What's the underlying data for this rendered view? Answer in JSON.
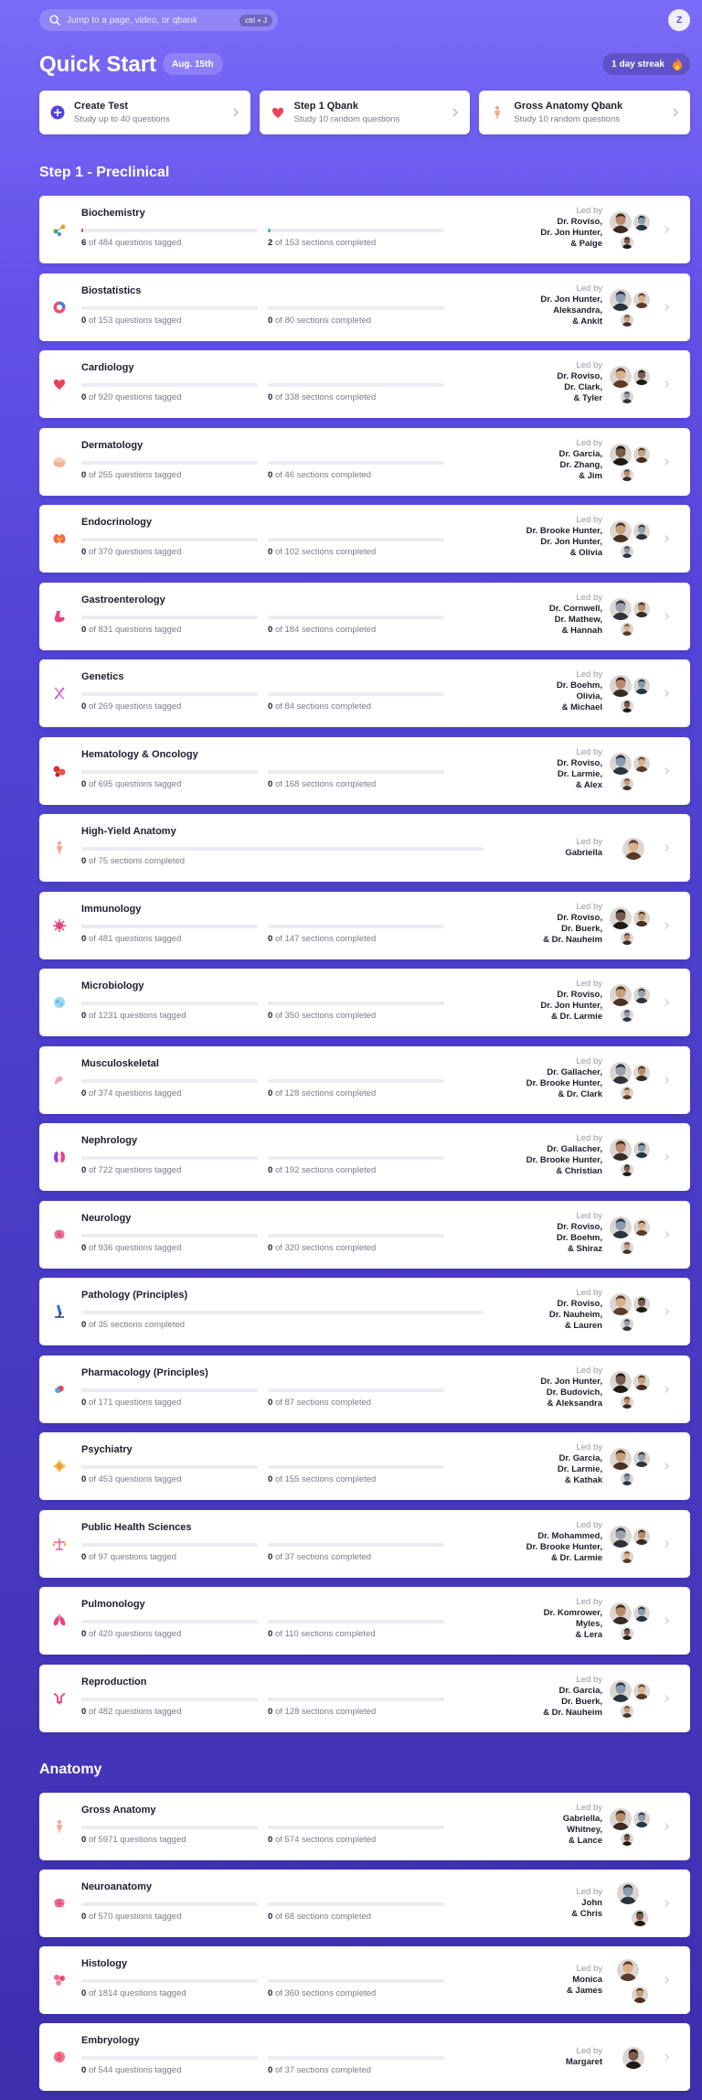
{
  "search": {
    "placeholder": "Jump to a page, video, or qbank",
    "shortcut": "ctrl + J"
  },
  "user": {
    "initial": "Z"
  },
  "header": {
    "title": "Quick Start",
    "date": "Aug. 15th",
    "streak": "1 day streak"
  },
  "quick": [
    {
      "title": "Create Test",
      "sub": "Study up to 40 questions"
    },
    {
      "title": "Step 1 Qbank",
      "sub": "Study 10 random questions"
    },
    {
      "title": "Gross Anatomy Qbank",
      "sub": "Study 10 random questions"
    }
  ],
  "sections": {
    "preclinical": "Step 1 - Preclinical",
    "anatomy": "Anatomy"
  },
  "labels": {
    "led_by": "Led by"
  },
  "preclinical": [
    {
      "name": "Biochemistry",
      "q_done": "6",
      "q_text": "of 484 questions tagged",
      "q_pct": 1.2,
      "s_done": "2",
      "s_text": "of 153 sections completed",
      "s_pct": 1.3,
      "leaders": [
        "Dr. Roviso,",
        "Dr. Jon Hunter,",
        "& Paige"
      ],
      "icon": "dna-molecule-icon"
    },
    {
      "name": "Biostatistics",
      "q_done": "0",
      "q_text": "of 153 questions tagged",
      "q_pct": 0,
      "s_done": "0",
      "s_text": "of 80 sections completed",
      "s_pct": 0,
      "leaders": [
        "Dr. Jon Hunter,",
        "Aleksandra,",
        "& Ankit"
      ],
      "icon": "pie-chart-icon"
    },
    {
      "name": "Cardiology",
      "q_done": "0",
      "q_text": "of 920 questions tagged",
      "q_pct": 0,
      "s_done": "0",
      "s_text": "of 338 sections completed",
      "s_pct": 0,
      "leaders": [
        "Dr. Roviso,",
        "Dr. Clark,",
        "& Tyler"
      ],
      "icon": "heart-icon"
    },
    {
      "name": "Dermatology",
      "q_done": "0",
      "q_text": "of 255 questions tagged",
      "q_pct": 0,
      "s_done": "0",
      "s_text": "of 46 sections completed",
      "s_pct": 0,
      "leaders": [
        "Dr. Garcia,",
        "Dr. Zhang,",
        "& Jim"
      ],
      "icon": "skin-icon"
    },
    {
      "name": "Endocrinology",
      "q_done": "0",
      "q_text": "of 370 questions tagged",
      "q_pct": 0,
      "s_done": "0",
      "s_text": "of 102 sections completed",
      "s_pct": 0,
      "leaders": [
        "Dr. Brooke Hunter,",
        "Dr. Jon Hunter,",
        "& Olivia"
      ],
      "icon": "thyroid-icon"
    },
    {
      "name": "Gastroenterology",
      "q_done": "0",
      "q_text": "of 831 questions tagged",
      "q_pct": 0,
      "s_done": "0",
      "s_text": "of 184 sections completed",
      "s_pct": 0,
      "leaders": [
        "Dr. Cornwell,",
        "Dr. Mathew,",
        "& Hannah"
      ],
      "icon": "stomach-icon"
    },
    {
      "name": "Genetics",
      "q_done": "0",
      "q_text": "of 269 questions tagged",
      "q_pct": 0,
      "s_done": "0",
      "s_text": "of 84 sections completed",
      "s_pct": 0,
      "leaders": [
        "Dr. Boehm,",
        "Olivia,",
        "& Michael"
      ],
      "icon": "dna-helix-icon"
    },
    {
      "name": "Hematology & Oncology",
      "q_done": "0",
      "q_text": "of 695 questions tagged",
      "q_pct": 0,
      "s_done": "0",
      "s_text": "of 168 sections completed",
      "s_pct": 0,
      "leaders": [
        "Dr. Roviso,",
        "Dr. Larmie,",
        "& Alex"
      ],
      "icon": "blood-cells-icon"
    },
    {
      "name": "High-Yield Anatomy",
      "single": true,
      "s_done": "0",
      "s_text": "of 75 sections completed",
      "s_pct": 0,
      "leaders": [
        "Gabriella"
      ],
      "icon": "body-icon"
    },
    {
      "name": "Immunology",
      "q_done": "0",
      "q_text": "of 481 questions tagged",
      "q_pct": 0,
      "s_done": "0",
      "s_text": "of 147 sections completed",
      "s_pct": 0,
      "leaders": [
        "Dr. Roviso,",
        "Dr. Buerk,",
        "& Dr. Nauheim"
      ],
      "icon": "virus-icon"
    },
    {
      "name": "Microbiology",
      "q_done": "0",
      "q_text": "of 1231 questions tagged",
      "q_pct": 0,
      "s_done": "0",
      "s_text": "of 350 sections completed",
      "s_pct": 0,
      "leaders": [
        "Dr. Roviso,",
        "Dr. Jon Hunter,",
        "& Dr. Larmie"
      ],
      "icon": "microbe-icon"
    },
    {
      "name": "Musculoskeletal",
      "q_done": "0",
      "q_text": "of 374 questions tagged",
      "q_pct": 0,
      "s_done": "0",
      "s_text": "of 128 sections completed",
      "s_pct": 0,
      "leaders": [
        "Dr. Gallacher,",
        "Dr. Brooke Hunter,",
        "& Dr. Clark"
      ],
      "icon": "arm-icon"
    },
    {
      "name": "Nephrology",
      "q_done": "0",
      "q_text": "of 722 questions tagged",
      "q_pct": 0,
      "s_done": "0",
      "s_text": "of 192 sections completed",
      "s_pct": 0,
      "leaders": [
        "Dr. Gallacher,",
        "Dr. Brooke Hunter,",
        "& Christian"
      ],
      "icon": "kidney-icon"
    },
    {
      "name": "Neurology",
      "q_done": "0",
      "q_text": "of 936 questions tagged",
      "q_pct": 0,
      "s_done": "0",
      "s_text": "of 320 sections completed",
      "s_pct": 0,
      "leaders": [
        "Dr. Roviso,",
        "Dr. Boehm,",
        "& Shiraz"
      ],
      "icon": "brain-icon"
    },
    {
      "name": "Pathology (Principles)",
      "single": true,
      "s_done": "0",
      "s_text": "of 35 sections completed",
      "s_pct": 0,
      "leaders": [
        "Dr. Roviso,",
        "Dr. Nauheim,",
        "& Lauren"
      ],
      "icon": "microscope-icon"
    },
    {
      "name": "Pharmacology (Principles)",
      "q_done": "0",
      "q_text": "of 171 questions tagged",
      "q_pct": 0,
      "s_done": "0",
      "s_text": "of 87 sections completed",
      "s_pct": 0,
      "leaders": [
        "Dr. Jon Hunter,",
        "Dr. Budovich,",
        "& Aleksandra"
      ],
      "icon": "pill-icon"
    },
    {
      "name": "Psychiatry",
      "q_done": "0",
      "q_text": "of 453 questions tagged",
      "q_pct": 0,
      "s_done": "0",
      "s_text": "of 155 sections completed",
      "s_pct": 0,
      "leaders": [
        "Dr. Garcia,",
        "Dr. Larmie,",
        "& Kathak"
      ],
      "icon": "mind-icon"
    },
    {
      "name": "Public Health Sciences",
      "q_done": "0",
      "q_text": "of 97 questions tagged",
      "q_pct": 0,
      "s_done": "0",
      "s_text": "of 37 sections completed",
      "s_pct": 0,
      "leaders": [
        "Dr. Mohammed,",
        "Dr. Brooke Hunter,",
        "& Dr. Larmie"
      ],
      "icon": "scale-icon"
    },
    {
      "name": "Pulmonology",
      "q_done": "0",
      "q_text": "of 420 questions tagged",
      "q_pct": 0,
      "s_done": "0",
      "s_text": "of 110 sections completed",
      "s_pct": 0,
      "leaders": [
        "Dr. Komrower,",
        "Myles,",
        "& Lera"
      ],
      "icon": "lungs-icon"
    },
    {
      "name": "Reproduction",
      "q_done": "0",
      "q_text": "of 482 questions tagged",
      "q_pct": 0,
      "s_done": "0",
      "s_text": "of 128 sections completed",
      "s_pct": 0,
      "leaders": [
        "Dr. Garcia,",
        "Dr. Buerk,",
        "& Dr. Nauheim"
      ],
      "icon": "uterus-icon"
    }
  ],
  "anatomy": [
    {
      "name": "Gross Anatomy",
      "q_done": "0",
      "q_text": "of 5971 questions tagged",
      "q_pct": 0,
      "s_done": "0",
      "s_text": "of 574 sections completed",
      "s_pct": 0,
      "leaders": [
        "Gabriella,",
        "Whitney,",
        "& Lance"
      ],
      "icon": "body-icon"
    },
    {
      "name": "Neuroanatomy",
      "q_done": "0",
      "q_text": "of 570 questions tagged",
      "q_pct": 0,
      "s_done": "0",
      "s_text": "of 68 sections completed",
      "s_pct": 0,
      "leaders": [
        "John",
        "& Chris"
      ],
      "avatars": 2,
      "icon": "brain-icon"
    },
    {
      "name": "Histology",
      "q_done": "0",
      "q_text": "of 1814 questions tagged",
      "q_pct": 0,
      "s_done": "0",
      "s_text": "of 360 sections completed",
      "s_pct": 0,
      "leaders": [
        "Monica",
        "& James"
      ],
      "avatars": 2,
      "icon": "cells-icon"
    },
    {
      "name": "Embryology",
      "q_done": "0",
      "q_text": "of 544 questions tagged",
      "q_pct": 0,
      "s_done": "0",
      "s_text": "of 37 sections completed",
      "s_pct": 0,
      "leaders": [
        "Margaret"
      ],
      "icon": "embryo-icon"
    }
  ],
  "colors": {
    "accent": "#5245d8",
    "progress_q": "#e8433f",
    "progress_s": "#2bb5e8"
  }
}
